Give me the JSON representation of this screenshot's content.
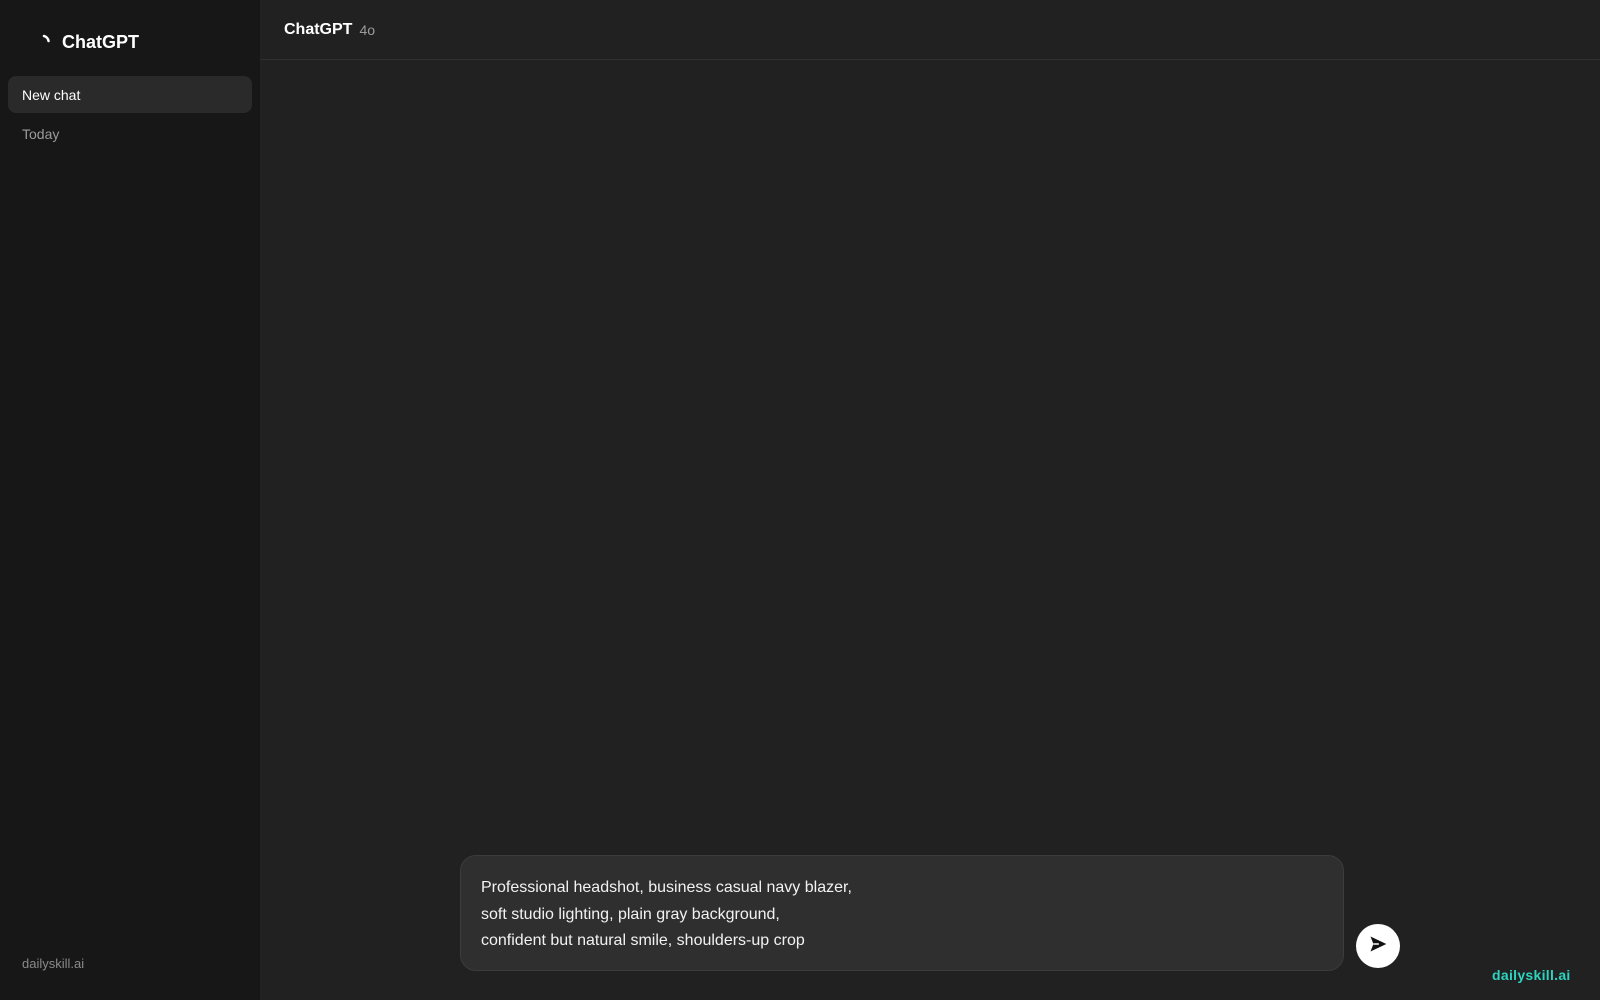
{
  "sidebar": {
    "brand_name": "ChatGPT",
    "brand_icon": "spinner-icon",
    "new_chat_label": "New chat",
    "section_label": "Today",
    "footer_text": "dailyskill.ai"
  },
  "header": {
    "title": "ChatGPT",
    "model": "4o"
  },
  "composer": {
    "lines": [
      "Professional headshot, business casual navy blazer,",
      "soft studio lighting, plain gray background,",
      "confident but natural smile, shoulders-up crop"
    ],
    "send_icon": "send-arrow-icon"
  },
  "watermark": "dailyskill.ai",
  "colors": {
    "background": "#212121",
    "sidebar": "#171717",
    "accent": "#2dd4bf"
  }
}
